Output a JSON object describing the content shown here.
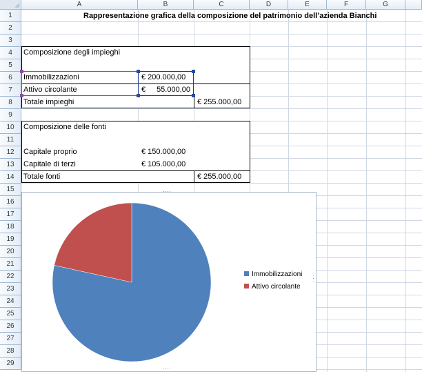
{
  "columns": [
    "A",
    "B",
    "C",
    "D",
    "E",
    "F",
    "G"
  ],
  "rows": [
    "1",
    "2",
    "3",
    "4",
    "5",
    "6",
    "7",
    "8",
    "9",
    "10",
    "11",
    "12",
    "13",
    "14",
    "15",
    "16",
    "17",
    "18",
    "19",
    "20",
    "21",
    "22",
    "23",
    "24",
    "25",
    "26",
    "27",
    "28",
    "29"
  ],
  "title": "Rappresentazione grafica della composizione del patrimonio dell’azienda Bianchi",
  "impieghi": {
    "header": "Composizione degli impieghi",
    "row1_label": "Immobilizzazioni",
    "row1_value": "€ 200.000,00",
    "row2_label": "Attivo circolante",
    "row2_currency": "€",
    "row2_amount": "55.000,00",
    "total_label": "Totale impieghi",
    "total_value": "€ 255.000,00"
  },
  "fonti": {
    "header": "Composizione delle fonti",
    "row1_label": "Capitale proprio",
    "row1_value": "€ 150.000,00",
    "row2_label": "Capitale di terzi",
    "row2_value": "€ 105.000,00",
    "total_label": "Totale fonti",
    "total_value": "€ 255.000,00"
  },
  "chart_data": {
    "type": "pie",
    "categories": [
      "Immobilizzazioni",
      "Attivo circolante"
    ],
    "values": [
      200000,
      55000
    ],
    "colors": [
      "#4f81bd",
      "#c0504d"
    ],
    "legend_position": "right"
  }
}
